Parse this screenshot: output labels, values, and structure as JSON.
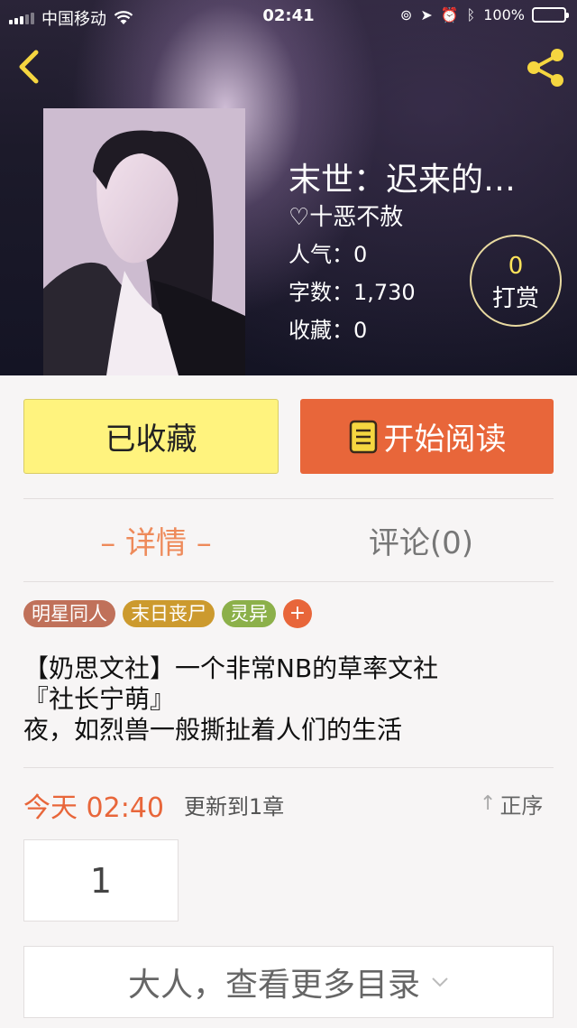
{
  "status_bar": {
    "carrier": "中国移动",
    "time": "02:41",
    "battery": "100%",
    "battery_level": 1.0,
    "icons": [
      "signal-icon",
      "wifi-icon",
      "lock-rotation-icon",
      "location-icon",
      "alarm-icon",
      "bluetooth-icon",
      "battery-icon"
    ]
  },
  "header": {
    "back_icon": "chevron-left-icon",
    "share_icon": "share-icon"
  },
  "book": {
    "title": "末世：迟来的…",
    "author": "♡十恶不赦",
    "stats": {
      "popularity": "人气：0",
      "word_count": "字数：1,730",
      "favorites": "收藏：0"
    },
    "tip": {
      "count": "0",
      "label": "打赏"
    }
  },
  "actions": {
    "favorite_label": "已收藏",
    "read_label": "开始阅读",
    "read_icon": "book-icon"
  },
  "tabs": {
    "details": "– 详情 –",
    "comments": "评论(0)"
  },
  "tags": [
    {
      "label": "明星同人",
      "color": "#c0715a"
    },
    {
      "label": "末日丧尸",
      "color": "#cc9a2e"
    },
    {
      "label": "灵异",
      "color": "#8cb04a"
    }
  ],
  "tag_add": "+",
  "description": [
    "【奶思文社】一个非常NB的草率文社",
    "『社长宁萌』",
    "夜，如烈兽一般撕扯着人们的生活"
  ],
  "update": {
    "date": "今天 02:40",
    "text": "更新到1章",
    "sort_label": "正序",
    "sort_icon": "↑"
  },
  "chapters": [
    "1"
  ],
  "more_catalog": "大人，查看更多目录",
  "colors": {
    "accent_orange": "#e8663a",
    "favorite_yellow": "#fff37e",
    "tip_gold": "#ffe35a"
  }
}
